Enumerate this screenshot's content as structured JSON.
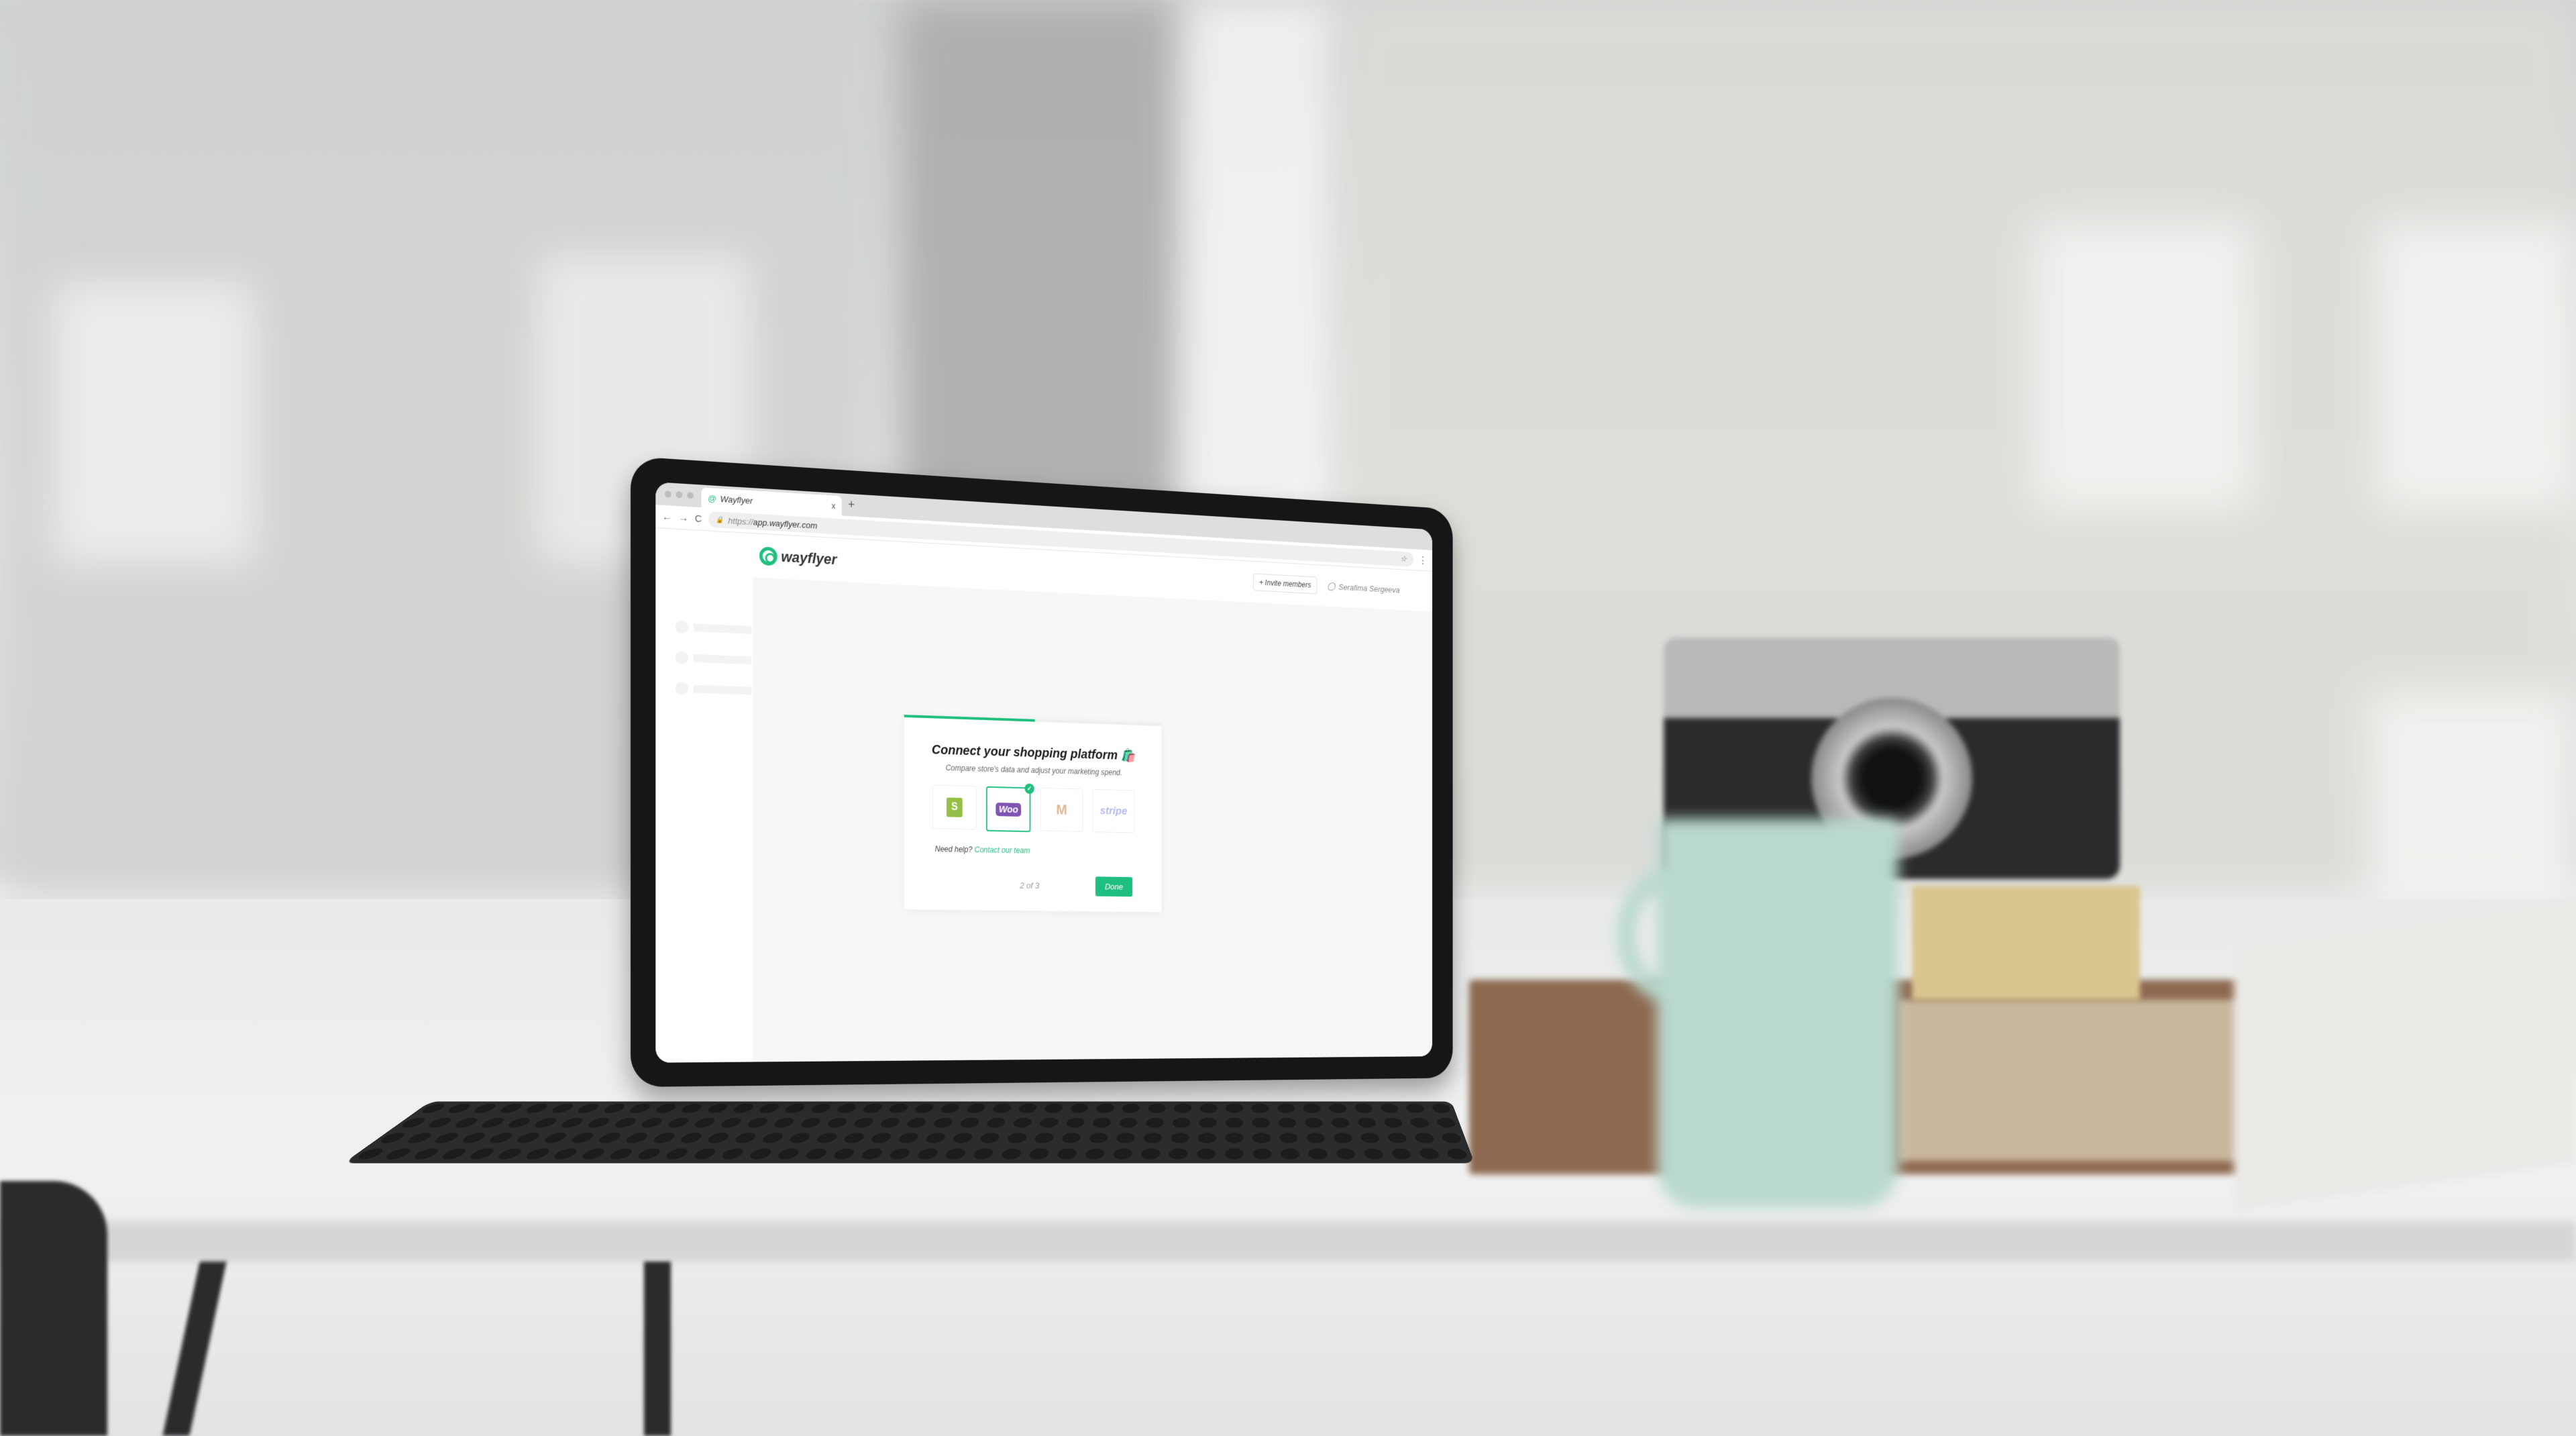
{
  "browser": {
    "tab_title": "Wayflyer",
    "tab_close": "x",
    "new_tab": "+",
    "back": "←",
    "forward": "→",
    "reload": "C",
    "lock": "🔒",
    "url_protocol": "https://",
    "url_host": "app.wayflyer.com",
    "bookmark": "☆",
    "menu": "⋮"
  },
  "app": {
    "logo_text": "wayflyer",
    "invite_label": "+ Invite members",
    "user_icon": "user-icon",
    "user_name": "Serafima Sergeeva"
  },
  "onboarding": {
    "progress_percent": 50,
    "title": "Connect your shopping platform",
    "title_emoji": "🛍️",
    "subtitle": "Compare store's data and adjust your marketing spend.",
    "platforms": [
      {
        "name": "Shopify",
        "glyph": "S",
        "selected": false
      },
      {
        "name": "WooCommerce",
        "glyph": "Woo",
        "selected": true
      },
      {
        "name": "Magento",
        "glyph": "M",
        "selected": false
      },
      {
        "name": "Stripe",
        "glyph": "stripe",
        "selected": false
      }
    ],
    "check_glyph": "✓",
    "help_prefix": "Need help?",
    "help_link": "Contact our team",
    "step": "2 of 3",
    "done_label": "Done"
  },
  "colors": {
    "accent": "#1fbf7f",
    "woo": "#7f54b3",
    "shopify": "#95bf47",
    "stripe": "#b5b8f5",
    "magento": "#e9b58f"
  }
}
